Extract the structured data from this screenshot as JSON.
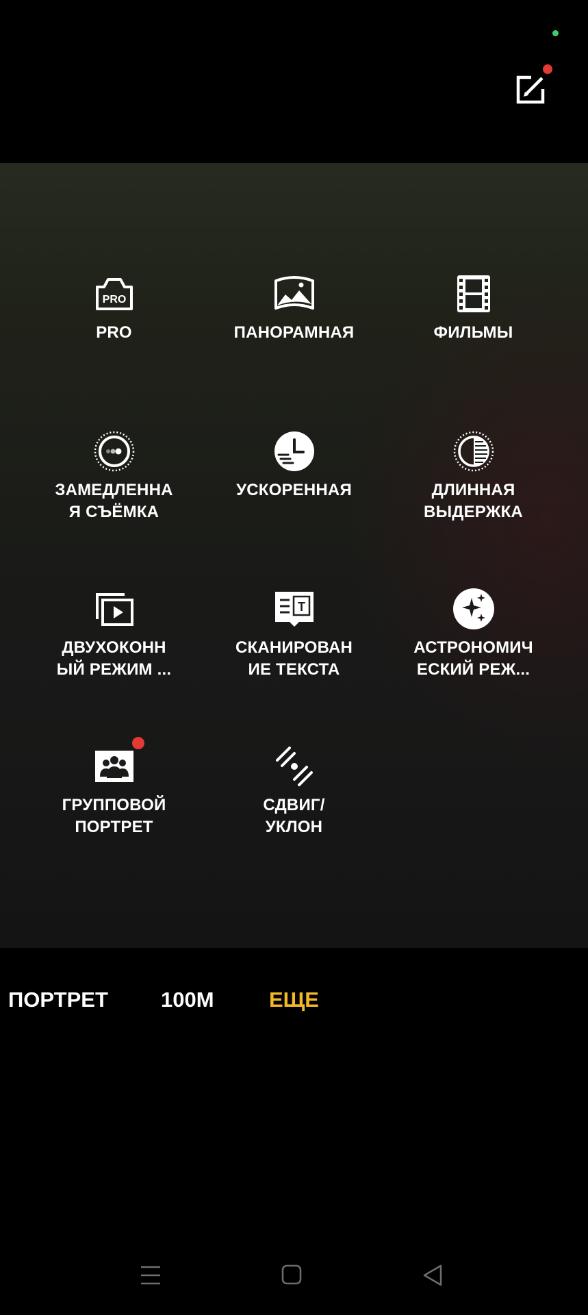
{
  "colors": {
    "status_dot": "#3ecf6e",
    "badge": "#e53935",
    "active_tab": "#f5b928"
  },
  "top": {
    "edit_icon": "edit-icon"
  },
  "modes": [
    {
      "label": "PRO",
      "icon": "pro-camera-icon",
      "badge": false
    },
    {
      "label": "ПАНОРАМНАЯ",
      "icon": "panorama-icon",
      "badge": false
    },
    {
      "label": "ФИЛЬМЫ",
      "icon": "film-icon",
      "badge": false
    },
    {
      "label": "ЗАМЕДЛЕННА\nЯ СЪЁМКА",
      "icon": "slow-motion-icon",
      "badge": false
    },
    {
      "label": "УСКОРЕННАЯ",
      "icon": "time-lapse-icon",
      "badge": false
    },
    {
      "label": "ДЛИННАЯ\nВЫДЕРЖКА",
      "icon": "long-exposure-icon",
      "badge": false
    },
    {
      "label": "ДВУХОКОНН\nЫЙ РЕЖИМ ...",
      "icon": "dual-view-icon",
      "badge": false
    },
    {
      "label": "СКАНИРОВАН\nИЕ ТЕКСТА",
      "icon": "text-scan-icon",
      "badge": false
    },
    {
      "label": "АСТРОНОМИЧ\nЕСКИЙ РЕЖ...",
      "icon": "astro-icon",
      "badge": false
    },
    {
      "label": "ГРУППОВОЙ\nПОРТРЕТ",
      "icon": "group-portrait-icon",
      "badge": true
    },
    {
      "label": "СДВИГ/\nУКЛОН",
      "icon": "tilt-shift-icon",
      "badge": false
    }
  ],
  "mode_bar": {
    "tabs": [
      "ПОРТРЕТ",
      "100M",
      "ЕЩЕ"
    ],
    "active": "ЕЩЕ"
  },
  "nav": {
    "icons": [
      "menu-icon",
      "home-icon",
      "back-icon"
    ]
  }
}
